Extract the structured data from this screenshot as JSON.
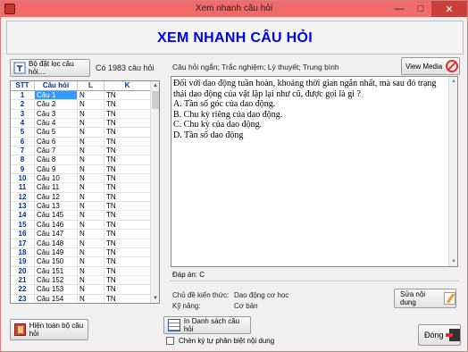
{
  "window": {
    "title": "Xem nhanh câu hỏi",
    "accent": "#f26a6a"
  },
  "header": {
    "title": "XEM NHANH CÂU HỎI",
    "title_color": "#0000ee"
  },
  "left": {
    "filter_button": "Bộ đặt lọc câu hỏi....",
    "count_text": "Có 1983 câu hỏi",
    "columns": [
      "STT",
      "Câu hỏi",
      "L",
      "K"
    ],
    "rows": [
      [
        "1",
        "Câu 1",
        "N",
        "TN"
      ],
      [
        "2",
        "Câu 2",
        "N",
        "TN"
      ],
      [
        "3",
        "Câu 3",
        "N",
        "TN"
      ],
      [
        "4",
        "Câu 4",
        "N",
        "TN"
      ],
      [
        "5",
        "Câu 5",
        "N",
        "TN"
      ],
      [
        "6",
        "Câu 6",
        "N",
        "TN"
      ],
      [
        "7",
        "Câu 7",
        "N",
        "TN"
      ],
      [
        "8",
        "Câu 8",
        "N",
        "TN"
      ],
      [
        "9",
        "Câu 9",
        "N",
        "TN"
      ],
      [
        "10",
        "Câu 10",
        "N",
        "TN"
      ],
      [
        "11",
        "Câu 11",
        "N",
        "TN"
      ],
      [
        "12",
        "Câu 12",
        "N",
        "TN"
      ],
      [
        "13",
        "Câu 13",
        "N",
        "TN"
      ],
      [
        "14",
        "Câu 145",
        "N",
        "TN"
      ],
      [
        "15",
        "Câu 146",
        "N",
        "TN"
      ],
      [
        "16",
        "Câu 147",
        "N",
        "TN"
      ],
      [
        "17",
        "Câu 148",
        "N",
        "TN"
      ],
      [
        "18",
        "Câu 149",
        "N",
        "TN"
      ],
      [
        "19",
        "Câu 150",
        "N",
        "TN"
      ],
      [
        "20",
        "Câu 151",
        "N",
        "TN"
      ],
      [
        "21",
        "Câu 152",
        "N",
        "TN"
      ],
      [
        "22",
        "Câu 153",
        "N",
        "TN"
      ],
      [
        "23",
        "Câu 154",
        "N",
        "TN"
      ]
    ],
    "show_all_button": "Hiện toàn bộ câu hỏi"
  },
  "right": {
    "meta": "Câu hỏi ngắn; Trắc nghiệm; Lý thuyết; Trung bình",
    "view_media_button": "View Media",
    "content_lines": [
      "Đối với dao động tuần hoàn, khoảng thời gian ngắn nhất, mà sau đó trạng thái dao động của vật lặp lại như cũ, được gọi là gì ?",
      "A. Tần số góc của dao động.",
      "B. Chu kỳ riêng của dao động.",
      "C. Chu kỳ của dao động.",
      "D. Tần số dao động"
    ],
    "answer": "Đáp án: C",
    "topic_label": "Chủ đề kiến thức:",
    "topic_value": "Dao động cơ học",
    "skill_label": "Kỹ năng:",
    "skill_value": "Cơ bản",
    "edit_button": "Sửa nội dung"
  },
  "footer": {
    "list_button": "In Danh sách câu hỏi",
    "checkbox_label": "Chèn ký tự phân biệt nội dung",
    "close_button": "Đóng"
  }
}
